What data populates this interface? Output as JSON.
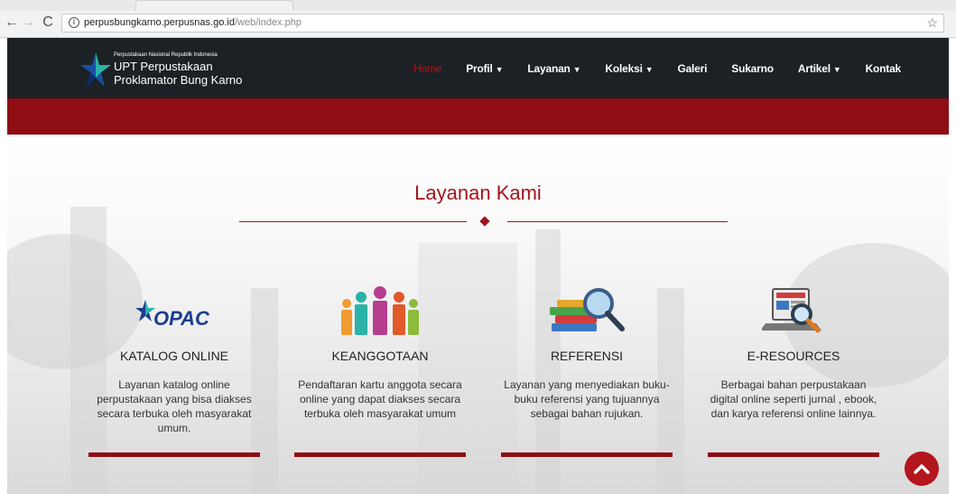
{
  "browser": {
    "url_host": "perpusbungkarno.perpusnas.go.id",
    "url_path": "/web/index.php",
    "back_glyph": "←",
    "forward_glyph": "→",
    "reload_glyph": "C",
    "info_glyph": "i",
    "star_glyph": "☆"
  },
  "logo": {
    "small_text": "Perpustakaan Nasional Republik Indonesia",
    "line1": "UPT Perpustakaan",
    "line2": "Proklamator Bung Karno"
  },
  "menu": {
    "items": [
      {
        "label": "Home",
        "caret": ""
      },
      {
        "label": "Profil",
        "caret": "▼"
      },
      {
        "label": "Layanan",
        "caret": "▼"
      },
      {
        "label": "Koleksi",
        "caret": "▼"
      },
      {
        "label": "Galeri",
        "caret": ""
      },
      {
        "label": "Sukarno",
        "caret": ""
      },
      {
        "label": "Artikel",
        "caret": "▼"
      },
      {
        "label": "Kontak",
        "caret": ""
      }
    ]
  },
  "section": {
    "title": "Layanan Kami"
  },
  "cards": [
    {
      "title": "KATALOG ONLINE",
      "desc": "Layanan katalog online perpustakaan yang bisa diakses secara terbuka oleh masyarakat umum.",
      "icon_text": "OPAC"
    },
    {
      "title": "KEANGGOTAAN",
      "desc": "Pendaftaran kartu anggota secara online yang dapat diakses secara terbuka oleh masyarakat umum"
    },
    {
      "title": "REFERENSI",
      "desc": "Layanan yang menyediakan buku-buku referensi yang tujuannya sebagai bahan rujukan."
    },
    {
      "title": "E-RESOURCES",
      "desc": "Berbagai bahan perpustakaan digital online seperti jurnal , ebook, dan karya referensi online lainnya."
    }
  ],
  "scroll_top_glyph": "⌃",
  "colors": {
    "brand_red": "#a3141c",
    "header_dark": "#1b2124",
    "band_red": "#8e0e14"
  }
}
